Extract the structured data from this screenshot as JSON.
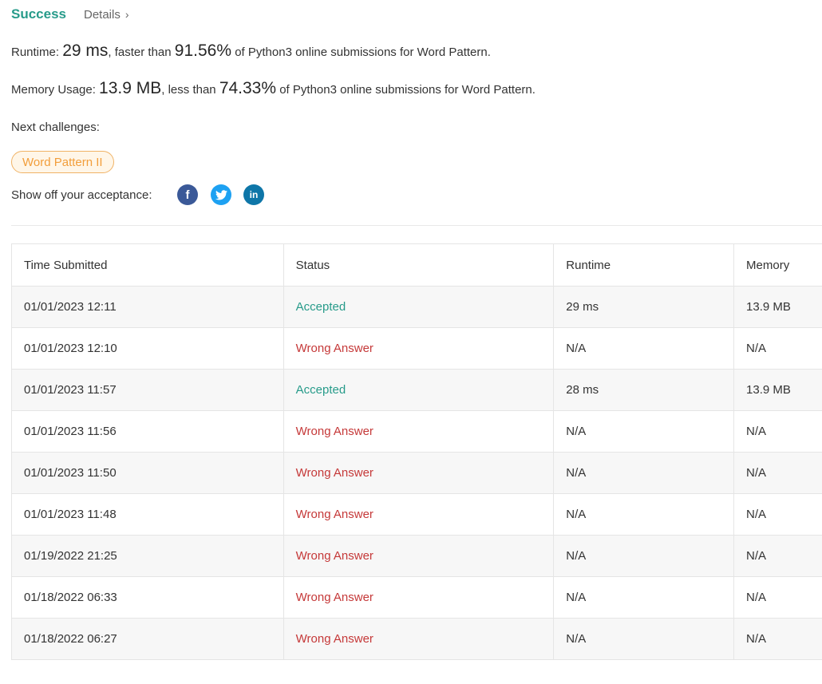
{
  "header": {
    "status": "Success",
    "details": "Details"
  },
  "runtime": {
    "label": "Runtime:",
    "value": "29 ms",
    "mid": ", faster than",
    "pct": "91.56%",
    "suffix": "of Python3 online submissions for Word Pattern."
  },
  "memory": {
    "label": "Memory Usage:",
    "value": "13.9 MB",
    "mid": ", less than",
    "pct": "74.33%",
    "suffix": "of Python3 online submissions for Word Pattern."
  },
  "next": {
    "label": "Next challenges:",
    "challenge": "Word Pattern II"
  },
  "share": {
    "label": "Show off your acceptance:",
    "icons": [
      "facebook-icon",
      "twitter-icon",
      "linkedin-icon"
    ]
  },
  "table": {
    "headers": [
      "Time Submitted",
      "Status",
      "Runtime",
      "Memory"
    ],
    "rows": [
      [
        "01/01/2023 12:11",
        "Accepted",
        "29 ms",
        "13.9 MB"
      ],
      [
        "01/01/2023 12:10",
        "Wrong Answer",
        "N/A",
        "N/A"
      ],
      [
        "01/01/2023 11:57",
        "Accepted",
        "28 ms",
        "13.9 MB"
      ],
      [
        "01/01/2023 11:56",
        "Wrong Answer",
        "N/A",
        "N/A"
      ],
      [
        "01/01/2023 11:50",
        "Wrong Answer",
        "N/A",
        "N/A"
      ],
      [
        "01/01/2023 11:48",
        "Wrong Answer",
        "N/A",
        "N/A"
      ],
      [
        "01/19/2022 21:25",
        "Wrong Answer",
        "N/A",
        "N/A"
      ],
      [
        "01/18/2022 06:33",
        "Wrong Answer",
        "N/A",
        "N/A"
      ],
      [
        "01/18/2022 06:27",
        "Wrong Answer",
        "N/A",
        "N/A"
      ]
    ]
  },
  "colors": {
    "accepted": "#279b8a",
    "wrong": "#c53838",
    "challenge": "#f29e3b"
  }
}
